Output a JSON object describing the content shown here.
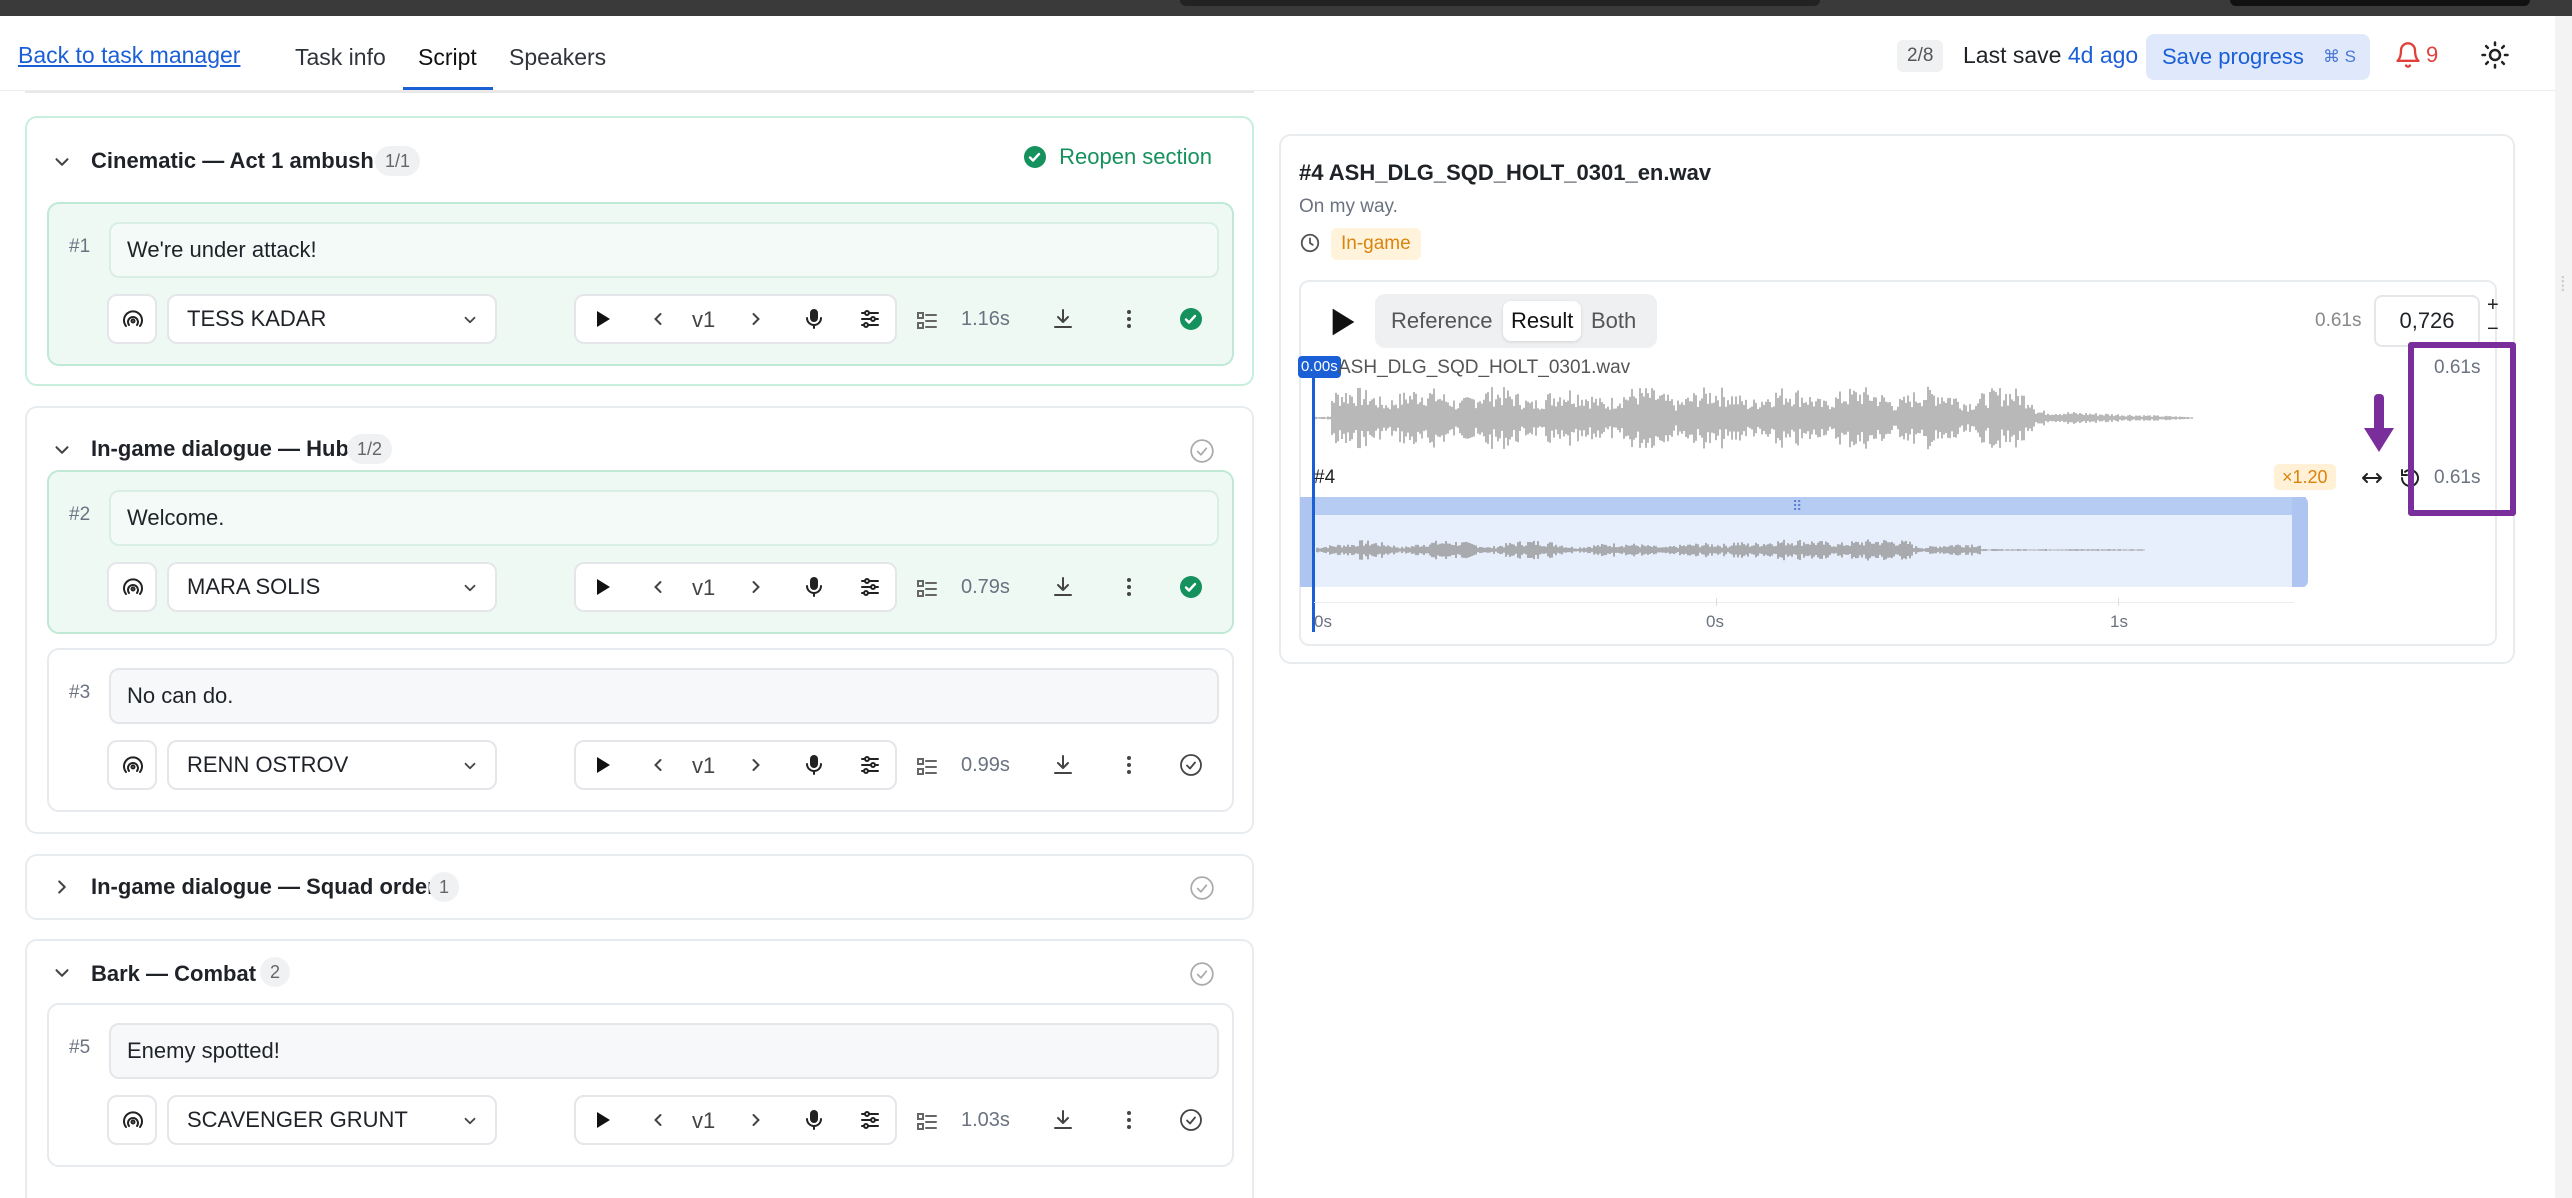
{
  "header": {
    "back_link": "Back to task manager",
    "tabs": [
      {
        "label": "Task info",
        "active": false
      },
      {
        "label": "Script",
        "active": true
      },
      {
        "label": "Speakers",
        "active": false
      }
    ],
    "progress_counter": "2/8",
    "last_save_label": "Last save",
    "last_save_ago": "4d ago",
    "save_button": "Save progress",
    "save_shortcut": "⌘ S",
    "notifications_count": "9",
    "accent_color": "#1a5fd6",
    "alert_color": "#e0413a"
  },
  "sections": [
    {
      "title": "Cinematic — Act 1 ambush",
      "badge": "1/1",
      "expanded": true,
      "completed": true,
      "reopen_label": "Reopen section",
      "lines": [
        {
          "num": "#1",
          "text": "We're under attack!",
          "speaker": "TESS KADAR",
          "version": "v1",
          "duration": "1.16s",
          "done": true
        }
      ]
    },
    {
      "title": "In-game dialogue — Hub",
      "badge": "1/2",
      "expanded": true,
      "completed": false,
      "lines": [
        {
          "num": "#2",
          "text": "Welcome.",
          "speaker": "MARA SOLIS",
          "version": "v1",
          "duration": "0.79s",
          "done": true
        },
        {
          "num": "#3",
          "text": "No can do.",
          "speaker": "RENN OSTROV",
          "version": "v1",
          "duration": "0.99s",
          "done": false
        }
      ]
    },
    {
      "title": "In-game dialogue — Squad order",
      "badge": "1",
      "expanded": false,
      "completed": false,
      "lines": []
    },
    {
      "title": "Bark — Combat",
      "badge": "2",
      "expanded": true,
      "completed": false,
      "lines": [
        {
          "num": "#5",
          "text": "Enemy spotted!",
          "speaker": "SCAVENGER GRUNT",
          "version": "v1",
          "duration": "1.03s",
          "done": false
        }
      ]
    }
  ],
  "detail": {
    "title": "#4 ASH_DLG_SQD_HOLT_0301_en.wav",
    "subtitle": "On my way.",
    "tag": "In-game",
    "tag_color": "#d9840d",
    "player": {
      "modes": [
        "Reference",
        "Result",
        "Both"
      ],
      "active_mode": "Result",
      "time": "0.61s",
      "rate_value": "0,726",
      "plus": "+",
      "minus": "−"
    },
    "cursor_label": "0.00s",
    "reference_label": "ASH_DLG_SQD_HOLT_0301.wav",
    "reference_time": "0.61s",
    "result_label": "#4",
    "speed_tag": "×1.20",
    "result_time": "0.61s",
    "axis_ticks": [
      "0s",
      "0s",
      "1s"
    ]
  },
  "annotation_color": "#7a2e9c"
}
